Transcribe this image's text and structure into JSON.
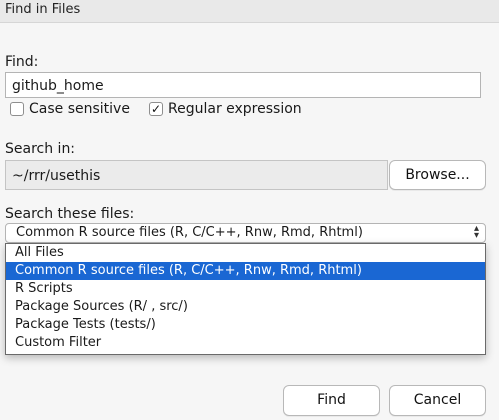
{
  "window": {
    "title": "Find in Files"
  },
  "find": {
    "label": "Find:",
    "value": "github_home",
    "case_sensitive": {
      "label": "Case sensitive",
      "checked": false
    },
    "regular_expression": {
      "label": "Regular expression",
      "checked": true,
      "mark": "✓"
    }
  },
  "search_in": {
    "label": "Search in:",
    "value": "~/rrr/usethis",
    "browse_label": "Browse..."
  },
  "search_files": {
    "label": "Search these files:",
    "selected": "Common R source files (R, C/C++, Rnw, Rmd, Rhtml)",
    "options": [
      "All Files",
      "Common R source files (R, C/C++, Rnw, Rmd, Rhtml)",
      "R Scripts",
      "Package Sources (R/ , src/)",
      "Package Tests (tests/)",
      "Custom Filter"
    ],
    "highlighted_index": 1,
    "accent_color": "#1a67d3"
  },
  "buttons": {
    "find_label": "Find",
    "cancel_label": "Cancel"
  }
}
